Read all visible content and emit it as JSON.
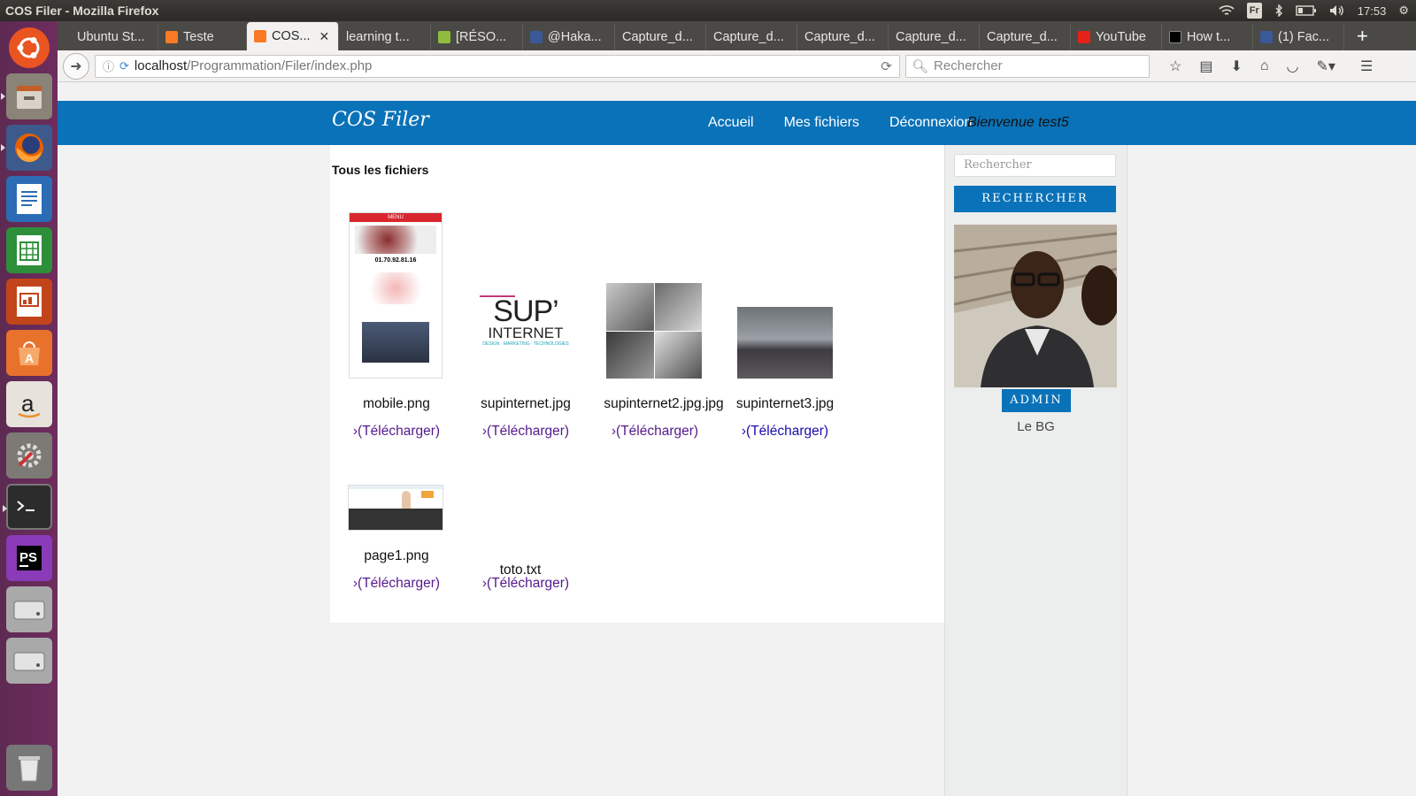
{
  "window": {
    "title": "COS Filer - Mozilla Firefox"
  },
  "tray": {
    "keyboard": "Fr",
    "time": "17:53"
  },
  "tabs": [
    {
      "label": "Ubuntu St...",
      "color": "#e95420"
    },
    {
      "label": "Teste",
      "color": "#fb7a24"
    },
    {
      "label": "COS...",
      "color": "#fb7a24",
      "active": true
    },
    {
      "label": "learning t...",
      "color": "#4a4945"
    },
    {
      "label": "[RÉSO...",
      "color": "#8fbc3f"
    },
    {
      "label": "@Haka...",
      "color": "#3b5998"
    },
    {
      "label": "Capture_d...",
      "color": "#4a4945"
    },
    {
      "label": "Capture_d...",
      "color": "#4a4945"
    },
    {
      "label": "Capture_d...",
      "color": "#4a4945"
    },
    {
      "label": "Capture_d...",
      "color": "#4a4945"
    },
    {
      "label": "Capture_d...",
      "color": "#4a4945"
    },
    {
      "label": "YouTube",
      "color": "#e62117"
    },
    {
      "label": "How t...",
      "color": "#000000"
    },
    {
      "label": "(1) Fac...",
      "color": "#3b5998"
    }
  ],
  "nav": {
    "url_host": "localhost",
    "url_path": "/Programmation/Filer/index.php",
    "search_placeholder": "Rechercher"
  },
  "site": {
    "brand": "COS Filer",
    "menu": [
      "Accueil",
      "Mes fichiers",
      "Déconnexion"
    ],
    "welcome": "Bienvenue test5",
    "section_title": "Tous les fichiers",
    "download_label": "›(Télécharger)",
    "files": [
      {
        "name": "mobile.png"
      },
      {
        "name": "supinternet.jpg"
      },
      {
        "name": "supinternet2.jpg.jpg"
      },
      {
        "name": "supinternet3.jpg"
      },
      {
        "name": "page1.png"
      },
      {
        "name": "toto.txt"
      }
    ],
    "thumb_texts": {
      "mobile_menu": "MENU",
      "mobile_phone": "01.70.92.81.16",
      "sup_big": "SUP’",
      "sup_mid": "INTERNET",
      "sup_small": "DESIGN · MARKETING · TECHNOLOGIES"
    }
  },
  "sidebar": {
    "search_placeholder": "Rechercher",
    "search_button": "RECHERCHER",
    "badge": "ADMIN",
    "subtitle": "Le BG"
  },
  "colors": {
    "accent": "#0a72b8",
    "launcher": "#6e2c5d"
  }
}
